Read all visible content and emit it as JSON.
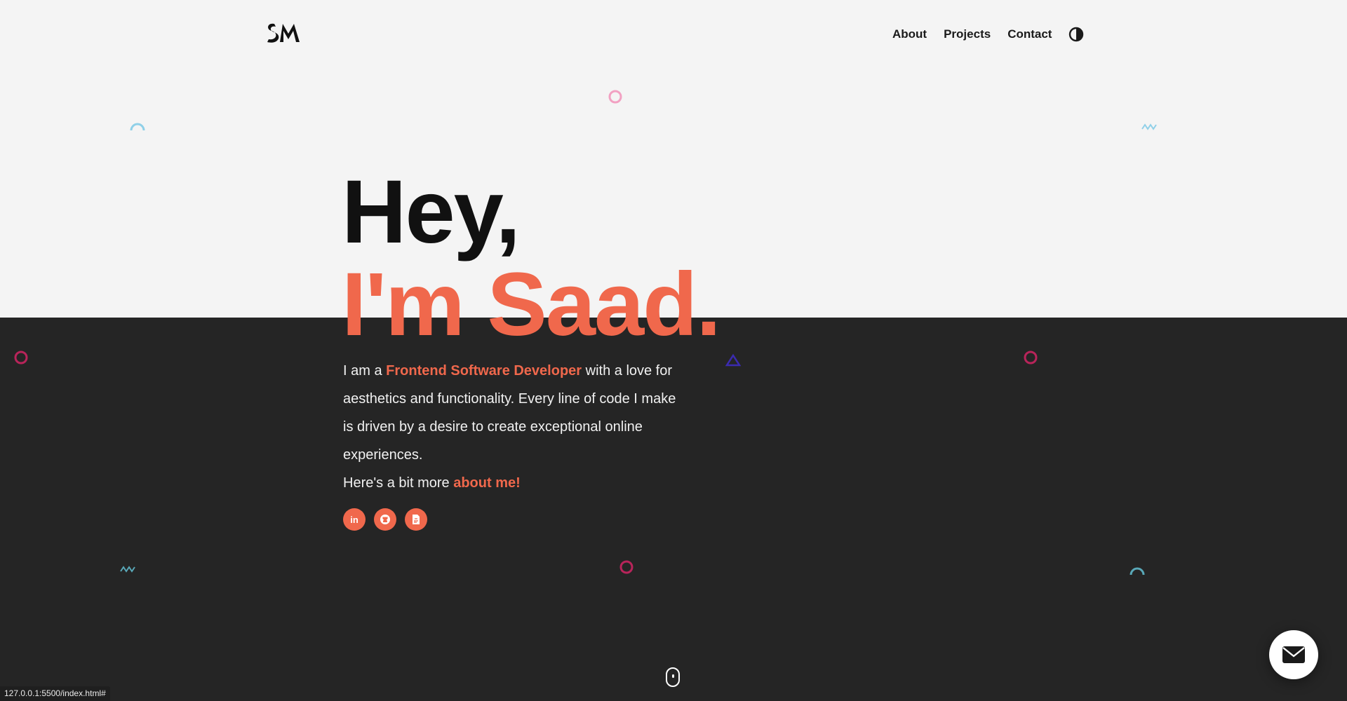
{
  "logo": {
    "text": "SM"
  },
  "nav": {
    "items": [
      {
        "label": "About"
      },
      {
        "label": "Projects"
      },
      {
        "label": "Contact"
      }
    ],
    "theme_toggle_icon": "contrast-icon"
  },
  "hero": {
    "greeting": "Hey,",
    "name": "I'm Saad.",
    "intro_prefix": "I am a ",
    "intro_role": "Frontend Software Developer",
    "intro_rest": " with a love for aesthetics and functionality. Every line of code I make is driven by a desire to create exceptional online experiences.",
    "more_prefix": "Here's a bit more ",
    "more_link": "about me!"
  },
  "socials": [
    {
      "name": "linkedin-icon",
      "glyph": "in"
    },
    {
      "name": "github-icon",
      "glyph": ""
    },
    {
      "name": "resume-file-icon",
      "glyph": ""
    }
  ],
  "mail_fab_icon": "envelope-icon",
  "scroll_indicator_icon": "mouse-scroll-icon",
  "status_bar": {
    "url": "127.0.0.1:5500/index.html#"
  },
  "colors": {
    "accent": "#f0684c",
    "dark_bg": "#252525",
    "light_bg": "#f4f4f4",
    "shape_pink": "#f2a1c2",
    "shape_crimson": "#b8245a",
    "shape_teal": "#59a8b8",
    "shape_lightblue": "#8fd0e8",
    "shape_indigo": "#3b2bb0"
  }
}
